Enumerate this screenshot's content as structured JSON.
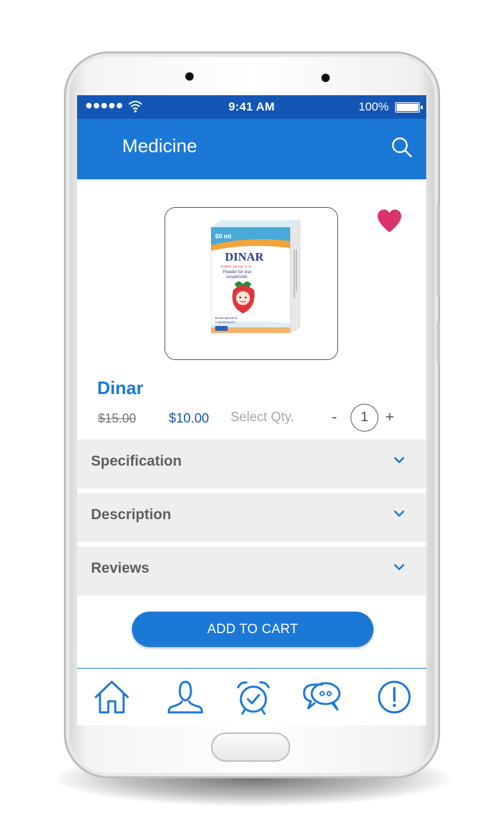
{
  "status_bar": {
    "time": "9:41 AM",
    "battery": "100%"
  },
  "app_bar": {
    "title": "Medicine"
  },
  "product": {
    "name": "Dinar",
    "old_price": "$15.00",
    "price": "$10.00",
    "qty_label": "Select Qty.",
    "qty_minus": "-",
    "qty_value": "1",
    "qty_plus": "+",
    "package": {
      "volume": "60 ml",
      "brand": "DINAR",
      "dose_line": "Cefdinir 125 mg / 5 ml",
      "form_line1": "Powder for oral",
      "form_line2": "suspension",
      "spectrum_line1": "Broad Spectrum",
      "spectrum_line2": "Cephalosporin"
    }
  },
  "sections": [
    {
      "label": "Specification"
    },
    {
      "label": "Description"
    },
    {
      "label": "Reviews"
    }
  ],
  "actions": {
    "add_to_cart": "ADD TO CART"
  },
  "bottom_nav": [
    {
      "icon": "home-icon"
    },
    {
      "icon": "user-icon"
    },
    {
      "icon": "alarm-clock-icon"
    },
    {
      "icon": "chat-icon"
    },
    {
      "icon": "info-icon"
    }
  ],
  "colors": {
    "status_bar": "#1456b6",
    "app_bar": "#1c78d6",
    "favorite": "#d8336b",
    "section_bg": "#efeeef"
  }
}
